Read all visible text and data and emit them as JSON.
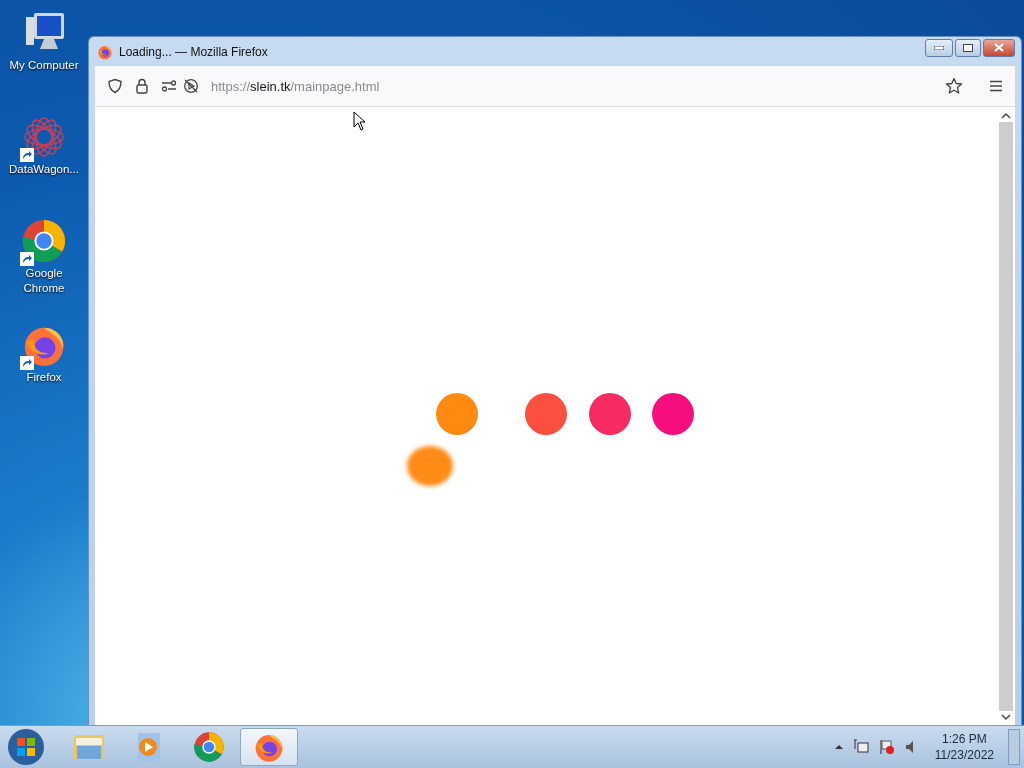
{
  "desktop_icons": [
    {
      "kind": "computer",
      "label": "My Computer",
      "shortcut": false
    },
    {
      "kind": "datawagon",
      "label": "DataWagon...",
      "shortcut": true
    },
    {
      "kind": "chrome",
      "label": "Google Chrome",
      "shortcut": true
    },
    {
      "kind": "firefox",
      "label": "Firefox",
      "shortcut": true
    }
  ],
  "window": {
    "title": "Loading... — Mozilla Firefox",
    "url": "https://**slein.tk**/mainpage.html"
  },
  "taskbar": {
    "items": [
      {
        "kind": "explorer",
        "selected": false
      },
      {
        "kind": "media",
        "selected": false
      },
      {
        "kind": "chrome",
        "selected": false
      },
      {
        "kind": "firefox",
        "selected": true
      }
    ],
    "time": "1:26 PM",
    "date": "11/23/2022"
  }
}
